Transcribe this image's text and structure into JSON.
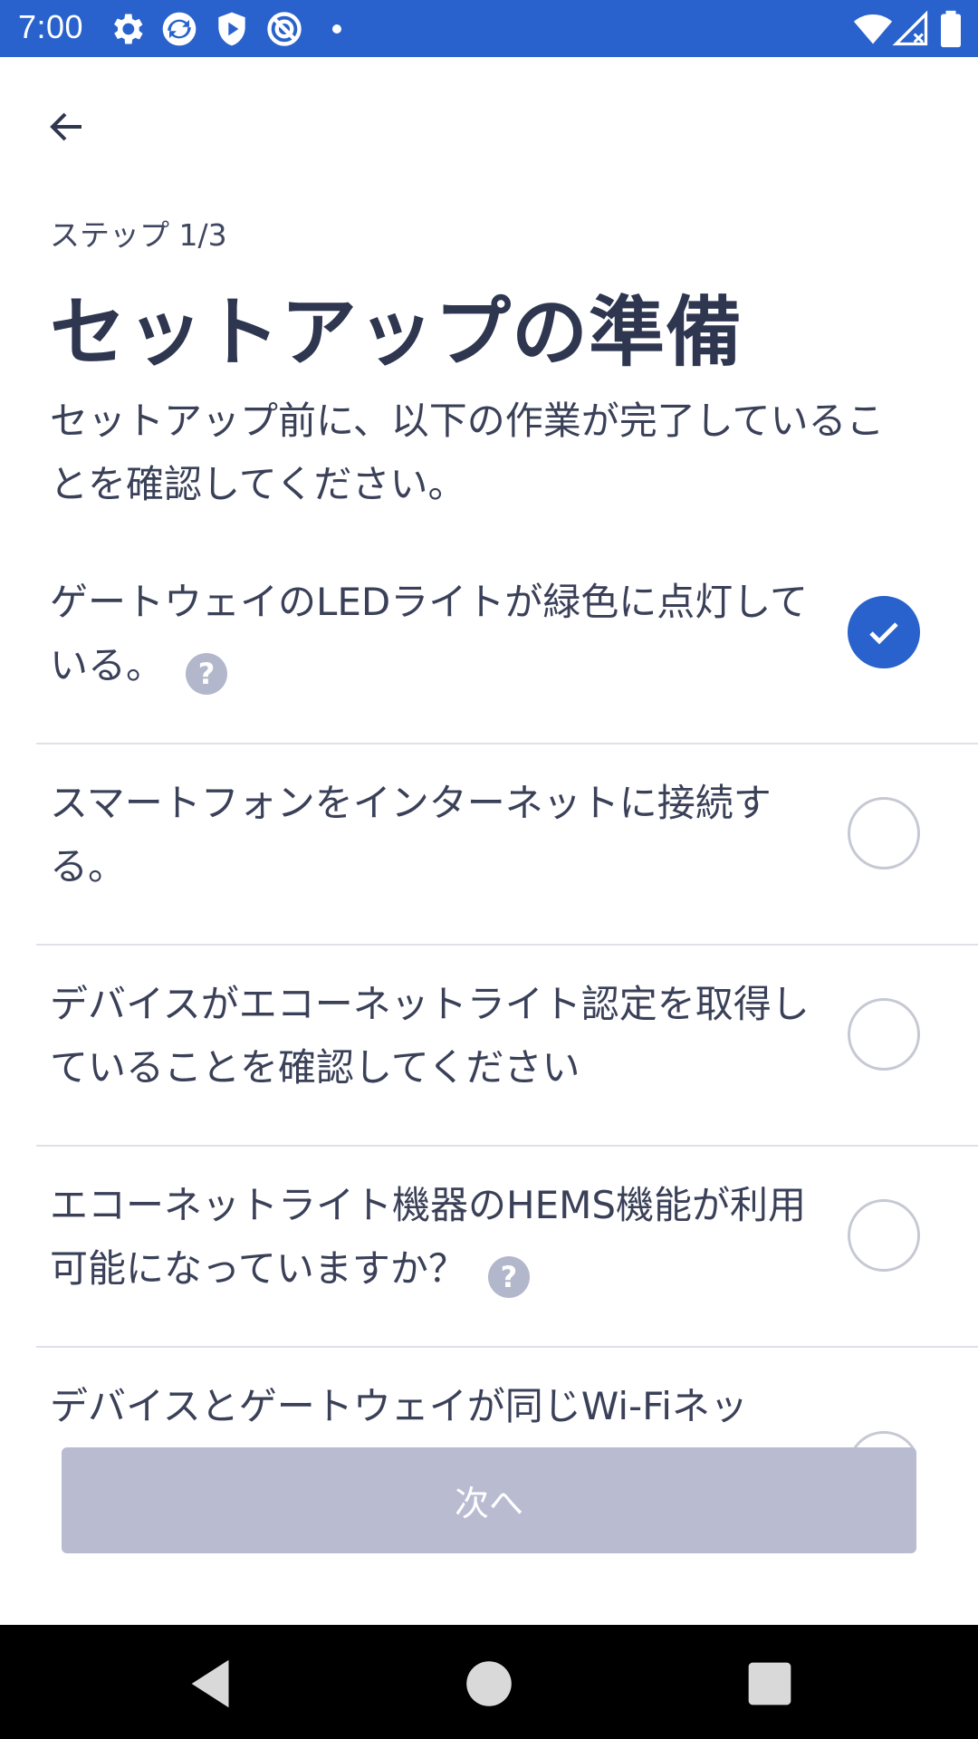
{
  "status_bar": {
    "time": "7:00",
    "left_icons": [
      "gear-icon",
      "sync-icon",
      "shield-play-icon",
      "no-sim-icon",
      "dot-icon"
    ],
    "right_icons": [
      "wifi-icon",
      "signal-icon",
      "battery-icon"
    ]
  },
  "header": {
    "back_icon": "back-arrow-icon",
    "step": "ステップ 1/3",
    "title": "セットアップの準備",
    "subtitle": "セットアップ前に、以下の作業が完了していることを確認してください。"
  },
  "checklist": [
    {
      "text": "ゲートウェイのLEDライトが緑色に点灯している。",
      "checked": true,
      "help": "?"
    },
    {
      "text": "スマートフォンをインターネットに接続する。",
      "checked": false
    },
    {
      "text": "デバイスがエコーネットライト認定を取得していることを確認してください",
      "checked": false
    },
    {
      "text": "エコーネットライト機器のHEMS機能が利用可能になっていますか？",
      "checked": false,
      "help": "?"
    },
    {
      "text": "デバイスとゲートウェイが同じWi-Fiネッ",
      "checked": false
    }
  ],
  "actions": {
    "next_label": "次へ"
  },
  "colors": {
    "primary": "#2962cc",
    "title": "#2e3650",
    "button_disabled": "#b9bcd1",
    "help_badge": "#b3b7cc"
  },
  "nav_bar": {
    "icons": [
      "nav-back-icon",
      "nav-home-icon",
      "nav-recents-icon"
    ]
  }
}
